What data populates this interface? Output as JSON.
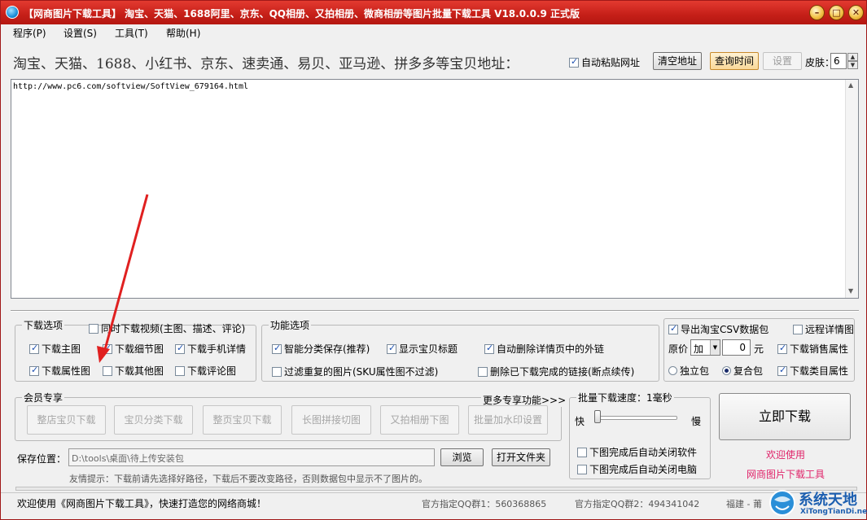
{
  "window": {
    "title": "【网商图片下载工具】 淘宝、天猫、1688阿里、京东、QQ相册、又拍相册、微商相册等图片批量下载工具 V18.0.0.9 正式版",
    "minimize_glyph": "–",
    "maximize_glyph": "□",
    "close_glyph": "✕"
  },
  "menu": [
    "程序(P)",
    "设置(S)",
    "工具(T)",
    "帮助(H)"
  ],
  "toolbar": {
    "address_label": "淘宝、天猫、1688、小红书、京东、速卖通、易贝、亚马逊、拼多多等宝贝地址：",
    "auto_paste_label": "自动粘贴网址",
    "auto_paste_checked": true,
    "clear_button": "清空地址",
    "query_time_button": "查询时间",
    "settings_button": "设置",
    "skin_label": "皮肤：",
    "skin_value": "6"
  },
  "url_area": {
    "value": "http://www.pc6.com/softview/SoftView_679164.html"
  },
  "download_options": {
    "title": "下载选项",
    "video_option": {
      "label": "同时下载视频(主图、描述、评论)",
      "checked": false
    },
    "items": [
      {
        "label": "下载主图",
        "checked": true
      },
      {
        "label": "下载细节图",
        "checked": true
      },
      {
        "label": "下载手机详情",
        "checked": true
      },
      {
        "label": "下载属性图",
        "checked": true
      },
      {
        "label": "下载其他图",
        "checked": false
      },
      {
        "label": "下载评论图",
        "checked": false
      }
    ]
  },
  "function_options": {
    "title": "功能选项",
    "items": [
      {
        "label": "智能分类保存(推荐)",
        "checked": true
      },
      {
        "label": "显示宝贝标题",
        "checked": true
      },
      {
        "label": "自动删除详情页中的外链",
        "checked": true
      },
      {
        "label": "过滤重复的图片(SKU属性图不过滤)",
        "checked": false
      },
      {
        "label": "删除已下载完成的链接(断点续传)",
        "checked": false
      }
    ]
  },
  "export_options": {
    "csv_label": "导出淘宝CSV数据包",
    "csv_checked": true,
    "remote_detail_label": "远程详情图",
    "remote_detail_checked": false,
    "price_label": "原价",
    "price_op": "加",
    "price_value": "0",
    "price_unit": "元",
    "sales_attr_label": "下载销售属性",
    "sales_attr_checked": true,
    "package_single": "独立包",
    "package_combined": "复合包",
    "package_selected": "复合包",
    "category_attr_label": "下载类目属性",
    "category_attr_checked": true
  },
  "member": {
    "title": "会员专享",
    "more_link": "更多专享功能>>>",
    "buttons": [
      "整店宝贝下载",
      "宝贝分类下载",
      "整页宝贝下载",
      "长图拼接切图",
      "又拍相册下图",
      "批量加水印设置"
    ]
  },
  "speed": {
    "title": "批量下载速度：1毫秒",
    "fast": "快",
    "slow": "慢",
    "level": 0.0,
    "close_app_label": "下图完成后自动关闭软件",
    "close_app_checked": false,
    "shutdown_label": "下图完成后自动关闭电脑",
    "shutdown_checked": false
  },
  "download_button": "立即下载",
  "welcome": {
    "line1": "欢迎使用",
    "line2": "网商图片下载工具"
  },
  "save": {
    "label": "保存位置：",
    "path": "D:\\tools\\桌面\\待上传安装包",
    "browse_button": "浏览",
    "open_folder_button": "打开文件夹",
    "tip": "友情提示：下载前请先选择好路径，下载后不要改变路径，否则数据包中显示不了图片的。"
  },
  "status": {
    "welcome": "欢迎使用《网商图片下载工具》，快速打造您的网络商城！",
    "qq_group1": "官方指定QQ群1：560368865",
    "qq_group2": "官方指定QQ群2：494341042",
    "region": "福建 - 莆"
  },
  "watermark": {
    "cn": "系统天地",
    "en": "XiTongTianDi.net"
  },
  "colors": {
    "titlebar": "#c51f18",
    "annotation_arrow": "#e02020",
    "link_pink": "#e0246a"
  }
}
